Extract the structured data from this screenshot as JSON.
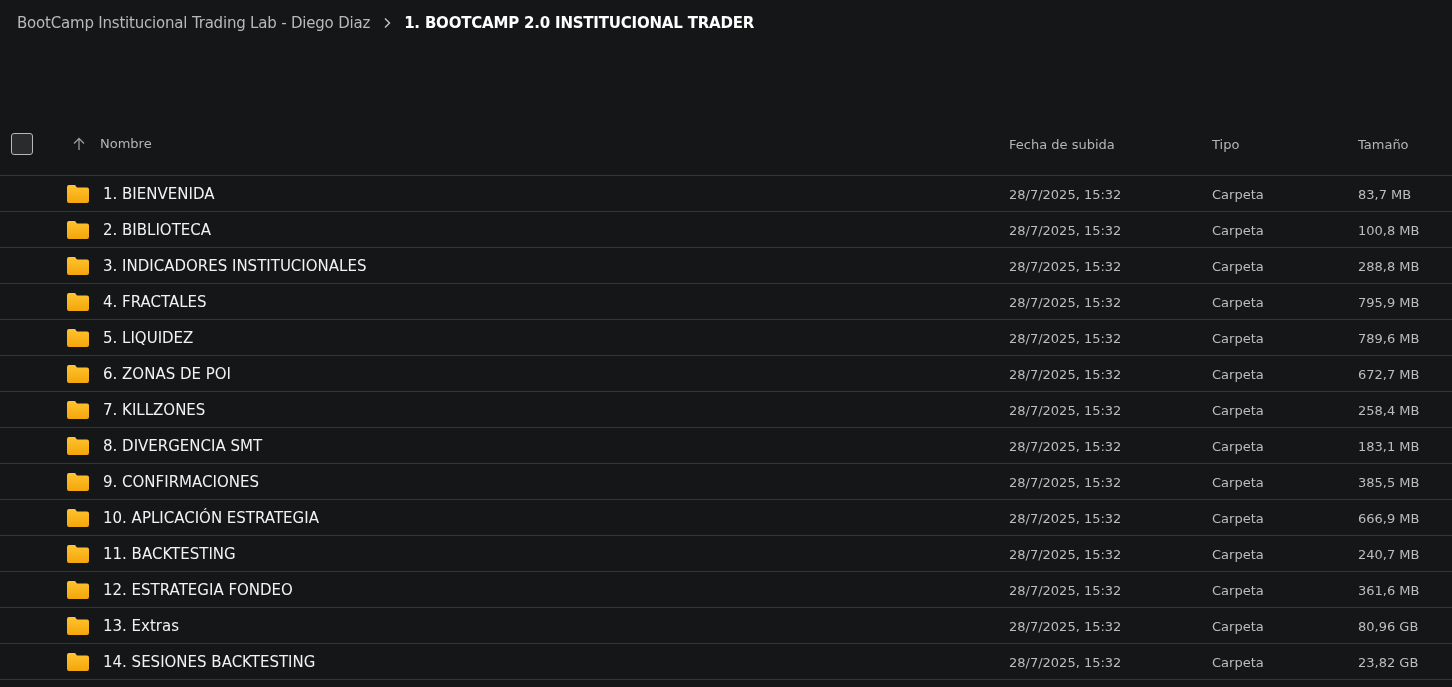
{
  "breadcrumb": [
    {
      "label": "BootCamp Institucional Trading Lab - Diego Diaz",
      "current": false
    },
    {
      "label": "1. BOOTCAMP 2.0 INSTITUCIONAL TRADER",
      "current": true
    }
  ],
  "table": {
    "select_all": {
      "checked": false
    },
    "columns": [
      "Nombre",
      "Fecha de subida",
      "Tipo",
      "Tamaño"
    ],
    "rows": [
      {
        "name": "1. BIENVENIDA",
        "date": "28/7/2025, 15:32",
        "type": "Carpeta",
        "size": "83,7 MB"
      },
      {
        "name": "2. BIBLIOTECA",
        "date": "28/7/2025, 15:32",
        "type": "Carpeta",
        "size": "100,8 MB"
      },
      {
        "name": "3. INDICADORES INSTITUCIONALES",
        "date": "28/7/2025, 15:32",
        "type": "Carpeta",
        "size": "288,8 MB"
      },
      {
        "name": "4. FRACTALES",
        "date": "28/7/2025, 15:32",
        "type": "Carpeta",
        "size": "795,9 MB"
      },
      {
        "name": "5. LIQUIDEZ",
        "date": "28/7/2025, 15:32",
        "type": "Carpeta",
        "size": "789,6 MB"
      },
      {
        "name": "6. ZONAS DE POI",
        "date": "28/7/2025, 15:32",
        "type": "Carpeta",
        "size": "672,7 MB"
      },
      {
        "name": "7. KILLZONES",
        "date": "28/7/2025, 15:32",
        "type": "Carpeta",
        "size": "258,4 MB"
      },
      {
        "name": "8. DIVERGENCIA SMT",
        "date": "28/7/2025, 15:32",
        "type": "Carpeta",
        "size": "183,1 MB"
      },
      {
        "name": "9. CONFIRMACIONES",
        "date": "28/7/2025, 15:32",
        "type": "Carpeta",
        "size": "385,5 MB"
      },
      {
        "name": "10. APLICACIÓN ESTRATEGIA",
        "date": "28/7/2025, 15:32",
        "type": "Carpeta",
        "size": "666,9 MB"
      },
      {
        "name": "11. BACKTESTING",
        "date": "28/7/2025, 15:32",
        "type": "Carpeta",
        "size": "240,7 MB"
      },
      {
        "name": "12. ESTRATEGIA FONDEO",
        "date": "28/7/2025, 15:32",
        "type": "Carpeta",
        "size": "361,6 MB"
      },
      {
        "name": "13. Extras",
        "date": "28/7/2025, 15:32",
        "type": "Carpeta",
        "size": "80,96 GB"
      },
      {
        "name": "14. SESIONES BACKTESTING",
        "date": "28/7/2025, 15:32",
        "type": "Carpeta",
        "size": "23,82 GB"
      }
    ]
  }
}
